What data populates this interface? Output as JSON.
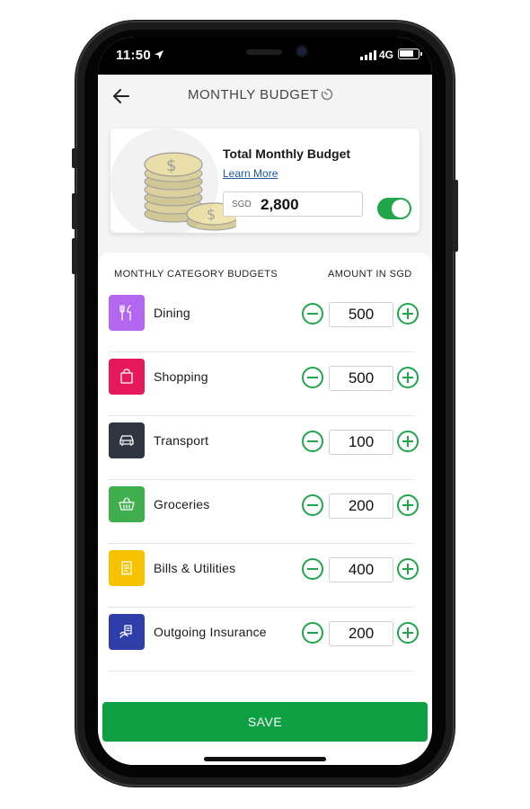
{
  "status_bar": {
    "time": "11:50",
    "network": "4G"
  },
  "header": {
    "title": "MONTHLY BUDGET"
  },
  "summary": {
    "title": "Total Monthly Budget",
    "learn_more": "Learn More",
    "currency": "SGD",
    "amount": "2,800",
    "toggle_on": true
  },
  "categories_panel": {
    "header_left": "MONTHLY CATEGORY BUDGETS",
    "header_right": "AMOUNT IN SGD",
    "items": [
      {
        "label": "Dining",
        "amount": "500",
        "icon": "dining-icon",
        "color": "#b366f0"
      },
      {
        "label": "Shopping",
        "amount": "500",
        "icon": "shopping-bag-icon",
        "color": "#e6195c"
      },
      {
        "label": "Transport",
        "amount": "100",
        "icon": "car-icon",
        "color": "#2f3640"
      },
      {
        "label": "Groceries",
        "amount": "200",
        "icon": "basket-icon",
        "color": "#3fae4d"
      },
      {
        "label": "Bills & Utilities",
        "amount": "400",
        "icon": "bill-icon",
        "color": "#f7c300"
      },
      {
        "label": "Outgoing Insurance",
        "amount": "200",
        "icon": "insurance-icon",
        "color": "#2e3ea8"
      }
    ]
  },
  "save_button": {
    "label": "SAVE"
  },
  "colors": {
    "accent_green": "#1fa64b",
    "save_green": "#10a044",
    "link_blue": "#1d5aa8"
  }
}
